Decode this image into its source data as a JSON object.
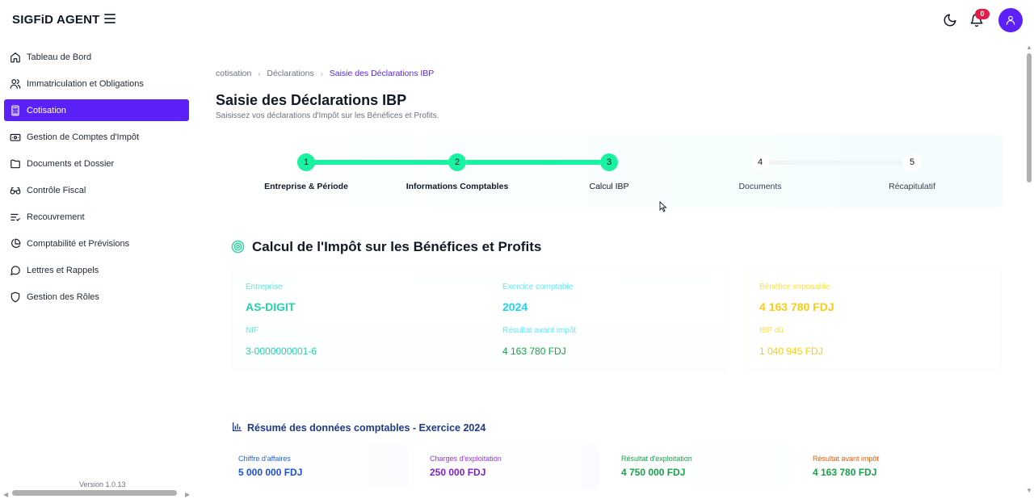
{
  "app": {
    "brand": "SIGFiD AGENT",
    "notifications_count": "0",
    "version": "Version 1.0.13"
  },
  "sidebar": {
    "items": [
      {
        "label": "Tableau de Bord",
        "icon": "home-icon",
        "active": false
      },
      {
        "label": "Immatriculation et Obligations",
        "icon": "users-icon",
        "active": false
      },
      {
        "label": "Cotisation",
        "icon": "calculator-icon",
        "active": true
      },
      {
        "label": "Gestion de Comptes d'Impôt",
        "icon": "wallet-icon",
        "active": false
      },
      {
        "label": "Documents et Dossier",
        "icon": "folder-icon",
        "active": false
      },
      {
        "label": "Contrôle Fiscal",
        "icon": "glasses-icon",
        "active": false
      },
      {
        "label": "Recouvrement",
        "icon": "list-check-icon",
        "active": false
      },
      {
        "label": "Comptabilité et Prévisions",
        "icon": "pie-chart-icon",
        "active": false
      },
      {
        "label": "Lettres et Rappels",
        "icon": "message-icon",
        "active": false
      },
      {
        "label": "Gestion des Rôles",
        "icon": "shield-icon",
        "active": false
      }
    ]
  },
  "breadcrumb": {
    "items": [
      "cotisation",
      "Déclarations",
      "Saisie des Déclarations IBP"
    ]
  },
  "page": {
    "title": "Saisie des Déclarations IBP",
    "subtitle": "Saisissez vos déclarations d'Impôt sur les Bénéfices et Profits."
  },
  "stepper": {
    "steps": [
      {
        "number": "1",
        "label": "Entreprise & Période",
        "state": "done"
      },
      {
        "number": "2",
        "label": "Informations Comptables",
        "state": "done"
      },
      {
        "number": "3",
        "label": "Calcul IBP",
        "state": "current"
      },
      {
        "number": "4",
        "label": "Documents",
        "state": "todo"
      },
      {
        "number": "5",
        "label": "Récapitulatif",
        "state": "todo"
      }
    ]
  },
  "calc": {
    "title": "Calcul de l'Impôt sur les Bénéfices et Profits",
    "entreprise_label": "Entreprise",
    "entreprise_value": "AS-DIGIT",
    "exercice_label": "Exercice comptable",
    "exercice_value": "2024",
    "benefice_label": "Bénéfice imposable",
    "benefice_value": "4 163 780 FDJ",
    "nif_label": "NIF",
    "nif_value": "3-0000000001-6",
    "resultat_label": "Résultat avant impôt",
    "resultat_value": "4 163 780 FDJ",
    "ibp_label": "IBP dû",
    "ibp_value": "1 040 945 FDJ"
  },
  "summary": {
    "title": "Résumé des données comptables - Exercice 2024",
    "cards": [
      {
        "label": "Chiffre d'affaires",
        "value": "5 000 000 FDJ",
        "color": "#1d4ed8"
      },
      {
        "label": "Charges d'exploitation",
        "value": "250 000 FDJ",
        "color": "#7e22ce"
      },
      {
        "label": "Résultat d'exploitation",
        "value": "4 750 000 FDJ",
        "color": "#16a34a"
      },
      {
        "label": "Résultat avant impôt",
        "value": "4 163 780 FDJ",
        "color": "#16a34a"
      }
    ]
  },
  "colors": {
    "accent": "#5b21f6",
    "step_done": "#19f2a0",
    "teal": "#22d3ae",
    "cyan": "#22d3ee",
    "yellow": "#facc15",
    "green": "#16a34a",
    "badge": "#e11d48"
  }
}
